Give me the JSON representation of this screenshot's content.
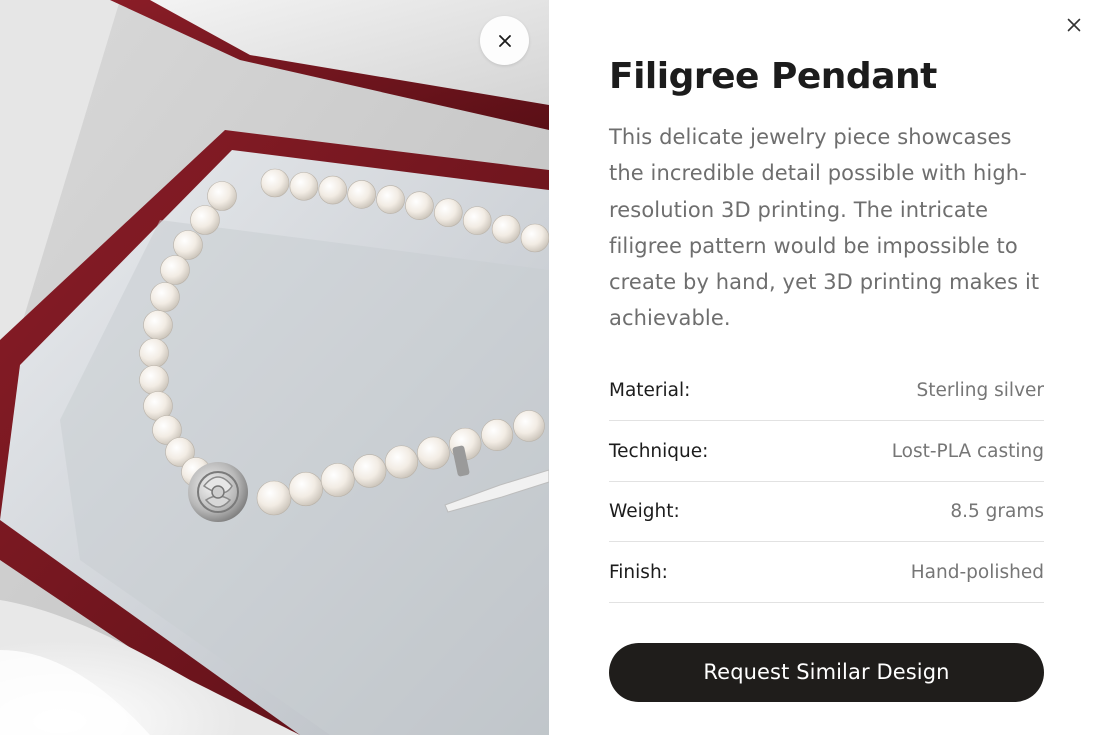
{
  "product": {
    "title": "Filigree Pendant",
    "description": "This delicate jewelry piece showcases the incredible detail possible with high-resolution 3D printing. The intricate filigree pattern would be impossible to create by hand, yet 3D printing makes it achievable."
  },
  "image": {
    "subject": "pearl necklace with flower clasp in red jewelry box",
    "close_icon": "close-icon"
  },
  "specs": [
    {
      "label": "Material:",
      "value": "Sterling silver"
    },
    {
      "label": "Technique:",
      "value": "Lost-PLA casting"
    },
    {
      "label": "Weight:",
      "value": "8.5 grams"
    },
    {
      "label": "Finish:",
      "value": "Hand-polished"
    }
  ],
  "actions": {
    "request_label": "Request Similar Design",
    "close_icon": "close-icon"
  },
  "colors": {
    "button_bg": "#1f1d1b",
    "title": "#1c1c1c",
    "muted_text": "#6e6e6e",
    "box_red": "#7a1620"
  }
}
